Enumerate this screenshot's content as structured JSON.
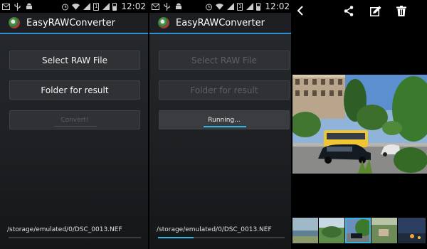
{
  "status_bar": {
    "time": "12:02",
    "sim_label": "1",
    "icons": [
      "email-icon",
      "usb-icon",
      "android-icon",
      "alarm-icon",
      "wifi-icon",
      "signal-icon",
      "sim-icon",
      "signal-icon",
      "battery-icon"
    ]
  },
  "panel_idle": {
    "app_title": "EasyRAWConverter",
    "select_raw_label": "Select RAW File",
    "folder_label": "Folder for result",
    "convert_label": "Convert!",
    "file_path": "/storage/emulated/0/DSC_0013.NEF",
    "progress": 0
  },
  "panel_running": {
    "app_title": "EasyRAWConverter",
    "select_raw_label": "Select RAW File",
    "folder_label": "Folder for result",
    "running_label": "Running...",
    "file_path": "/storage/emulated/0/DSC_0013.NEF",
    "progress": 0.28
  },
  "gallery": {
    "icons": [
      "back-icon",
      "share-icon",
      "edit-icon",
      "delete-icon"
    ],
    "thumbnail_count": 5,
    "selected_thumbnail": 3
  },
  "colors": {
    "accent": "#33b5e5",
    "actionbar_line": "#2f8fd1",
    "button_bg": "#2f3135"
  }
}
